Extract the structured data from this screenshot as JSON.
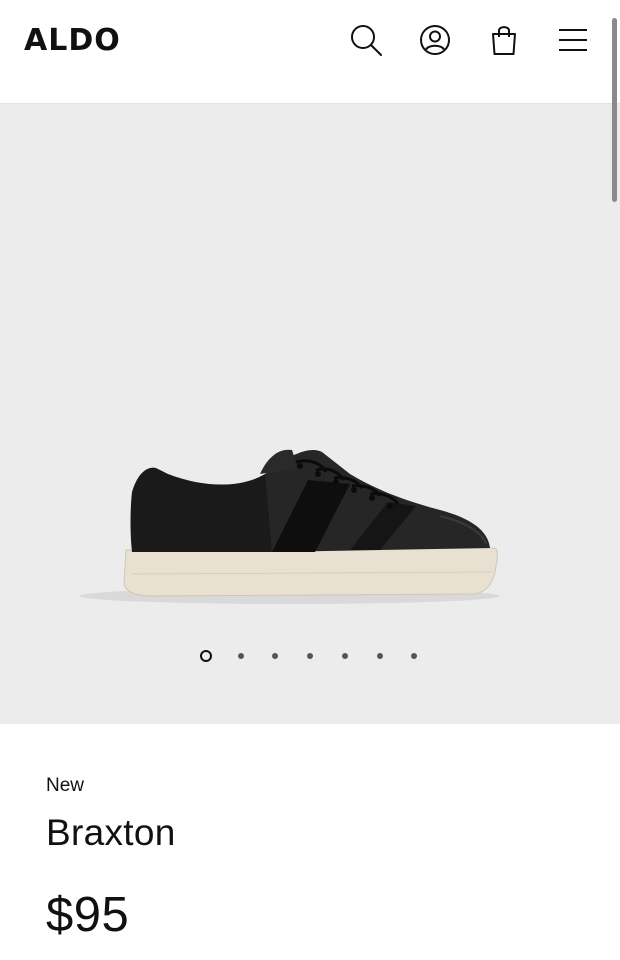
{
  "header": {
    "logo": "ALDO",
    "icons": {
      "search": "search-icon",
      "account": "account-icon",
      "bag": "shopping-bag-icon",
      "menu": "menu-icon"
    }
  },
  "gallery": {
    "image_alt": "Braxton black leather sneaker",
    "total_images": 7,
    "active_index": 0,
    "colors": {
      "background": "#ececec",
      "shoe_upper": "#1c1c1c",
      "sole": "#e8e1d2"
    }
  },
  "product": {
    "badge": "New",
    "name": "Braxton",
    "price": "$95"
  }
}
